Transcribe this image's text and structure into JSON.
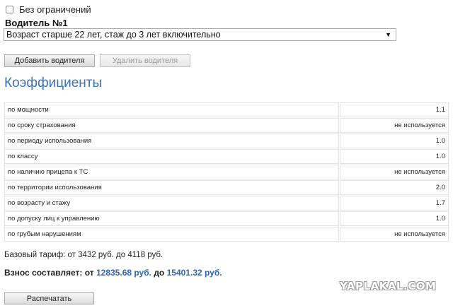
{
  "form": {
    "no_limit_label": "Без ограничений",
    "driver_label": "Водитель №1",
    "driver_select_value": "Возраст старше 22 лет, стаж до 3 лет включительно",
    "add_driver_button": "Добавить водителя",
    "remove_driver_button": "Удалить водителя"
  },
  "coefficients": {
    "title": "Коэффициенты",
    "rows": [
      {
        "label": "по мощности",
        "value": "1.1"
      },
      {
        "label": "по сроку страхования",
        "value": "не используется"
      },
      {
        "label": "по периоду использования",
        "value": "1.0"
      },
      {
        "label": "по классу",
        "value": "1.0"
      },
      {
        "label": "по наличию прицепа к ТС",
        "value": "не используется"
      },
      {
        "label": "по территории использования",
        "value": "2.0"
      },
      {
        "label": "по возрасту и стажу",
        "value": "1.7"
      },
      {
        "label": "по допуску лиц к управлению",
        "value": "1.0"
      },
      {
        "label": "по грубым нарушениям",
        "value": "не используется"
      }
    ]
  },
  "summary": {
    "base_rate_text": "Базовый тариф: от 3432 руб. до 4118 руб.",
    "total_label": "Взнос составляет:",
    "total_from_word": "от",
    "total_from_value": "12835.68 руб.",
    "total_to_word": "до",
    "total_to_value": "15401.32 руб."
  },
  "print_button": "Распечатать",
  "watermark": "YAPLAKAL.COM",
  "colors": {
    "accent": "#3a73b4",
    "total_numbers": "#2e64b0"
  }
}
